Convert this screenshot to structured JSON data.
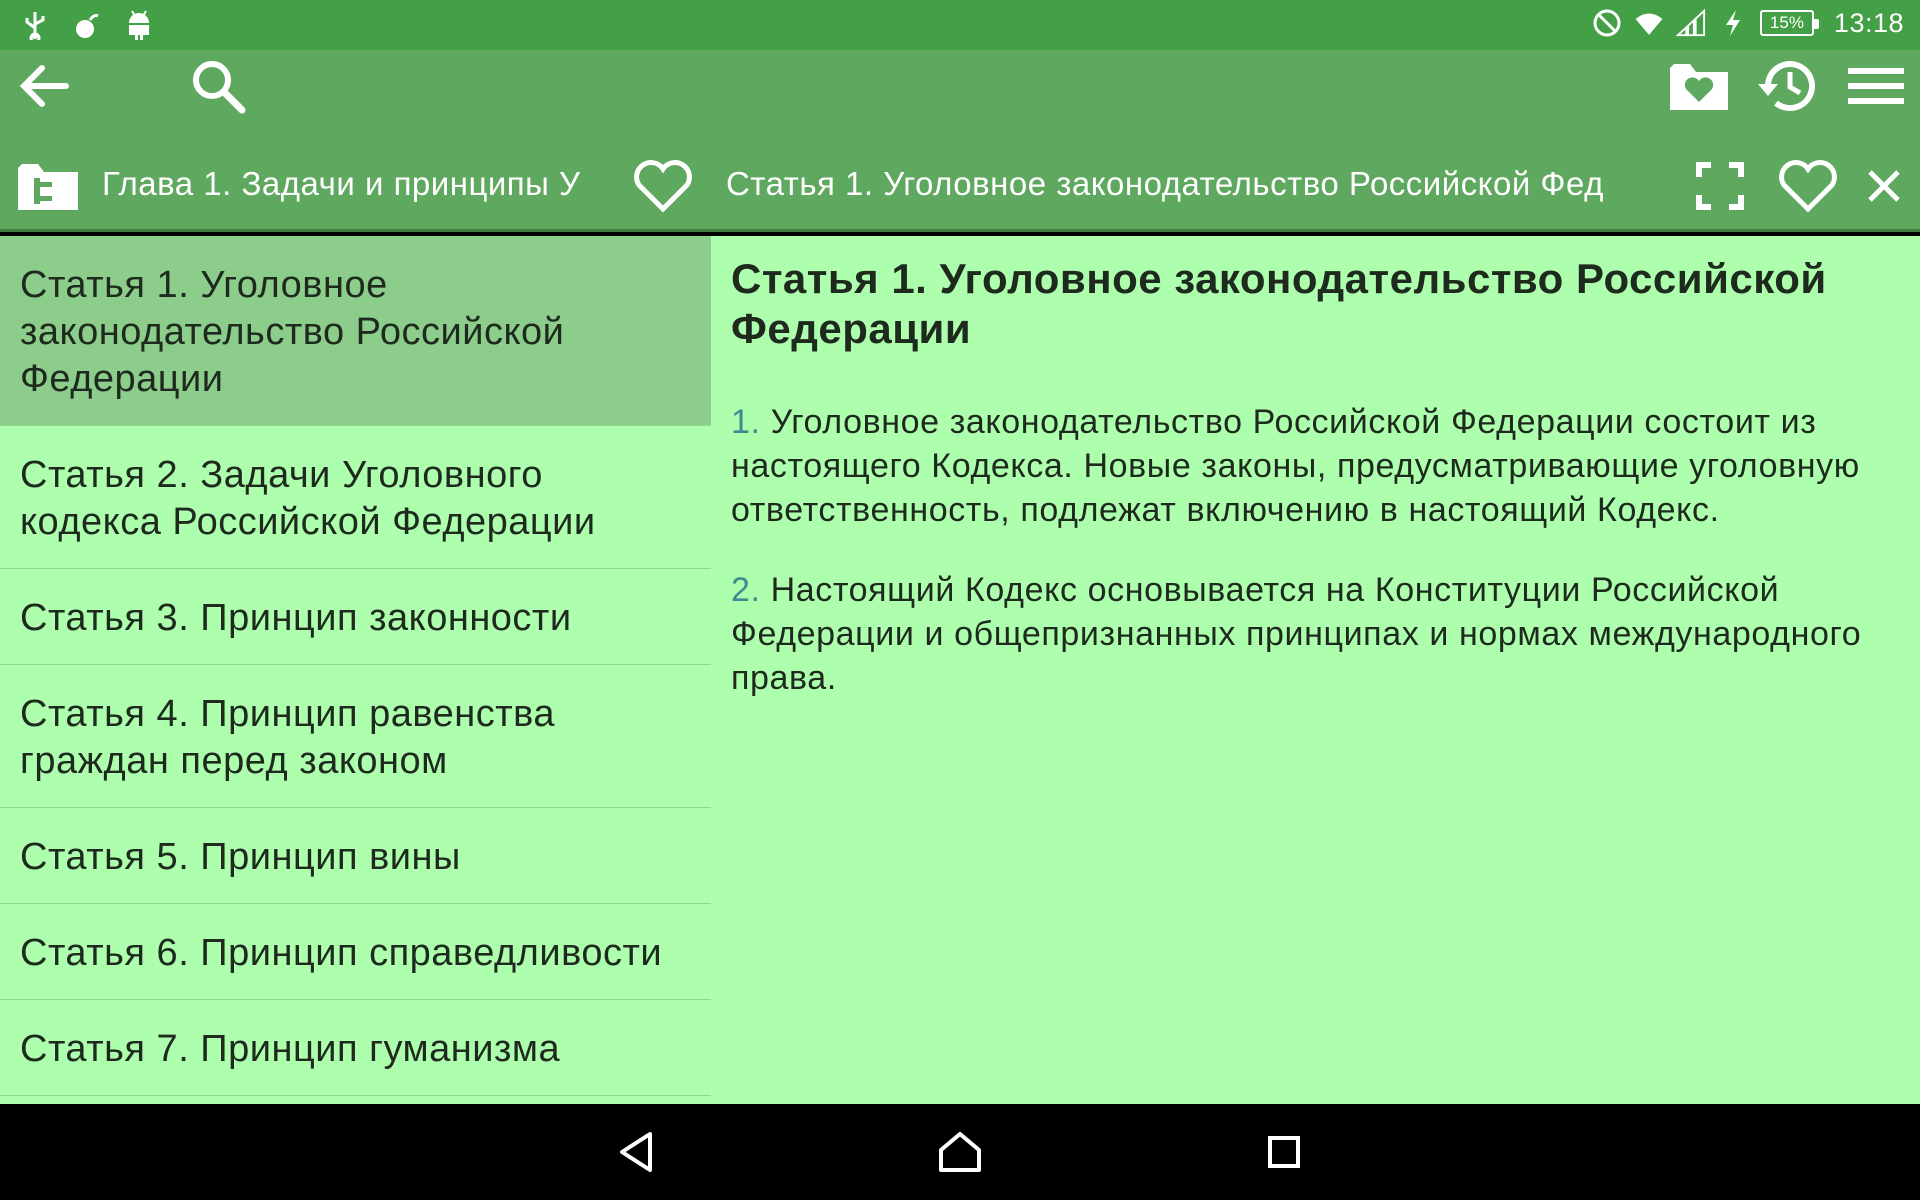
{
  "status_bar": {
    "time": "13:18",
    "battery": "15%",
    "left_icons": [
      "usb-icon",
      "bomb-icon",
      "android-icon"
    ],
    "right_icons": [
      "do-not-disturb-icon",
      "wifi-icon",
      "signal-icon",
      "charging-icon",
      "battery-icon"
    ]
  },
  "toolbar": {
    "icons": [
      "back-arrow-icon",
      "search-icon",
      "favorites-folder-icon",
      "history-icon",
      "menu-icon"
    ]
  },
  "tabs": {
    "chapter": "Глава 1. Задачи и принципы У",
    "article": "Статья 1. Уголовное законодательство Российской Фед"
  },
  "list": {
    "items": [
      {
        "label": "Статья 1. Уголовное законодательство Российской Федерации"
      },
      {
        "label": "Статья 2. Задачи Уголовного кодекса Российской Федерации"
      },
      {
        "label": "Статья 3. Принцип законности"
      },
      {
        "label": "Статья 4. Принцип равенства граждан перед законом"
      },
      {
        "label": "Статья 5. Принцип вины"
      },
      {
        "label": "Статья 6. Принцип справедливости"
      },
      {
        "label": "Статья 7. Принцип гуманизма"
      }
    ]
  },
  "article": {
    "title": "Статья 1. Уголовное законодательство Российской Федерации",
    "paragraphs": [
      {
        "num": "1.",
        "text": " Уголовное законодательство Российской Федерации состоит из настоящего Кодекса. Новые законы, предусматривающие уголовную ответственность, подлежат включению в настоящий Кодекс."
      },
      {
        "num": "2.",
        "text": " Настоящий Кодекс основывается на Конституции Российской Федерации и общепризнанных принципах и нормах международного права."
      }
    ]
  },
  "colors": {
    "status_bar": "#43a047",
    "toolbar": "#5fa85f",
    "background": "#adffad",
    "selected": "#8ccd8c",
    "number_accent": "#3d8a90"
  }
}
